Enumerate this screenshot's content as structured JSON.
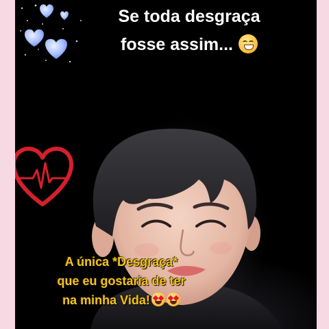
{
  "top_caption": {
    "line1": "Se toda desgraça",
    "line2": "fosse assim...",
    "emoji": "grinning-face-emoji"
  },
  "bottom_caption": {
    "line1": "A única *Desgraça*",
    "line2": "que eu gostaria de ter",
    "line3": "na minha Vida!",
    "emojis": [
      "heart-eyes-cat-emoji",
      "heart-eyes-emoji"
    ]
  },
  "decorations": {
    "hearts": "sparkling-blue-hearts",
    "pulse_heart": "red-heart-heartbeat-icon"
  },
  "colors": {
    "background": "#000000",
    "border": "#f7d9e4",
    "top_text": "#ffffff",
    "bottom_text": "#f2c21a",
    "heart_red": "#d4202c",
    "heart_blue": "#9bb8ff"
  }
}
